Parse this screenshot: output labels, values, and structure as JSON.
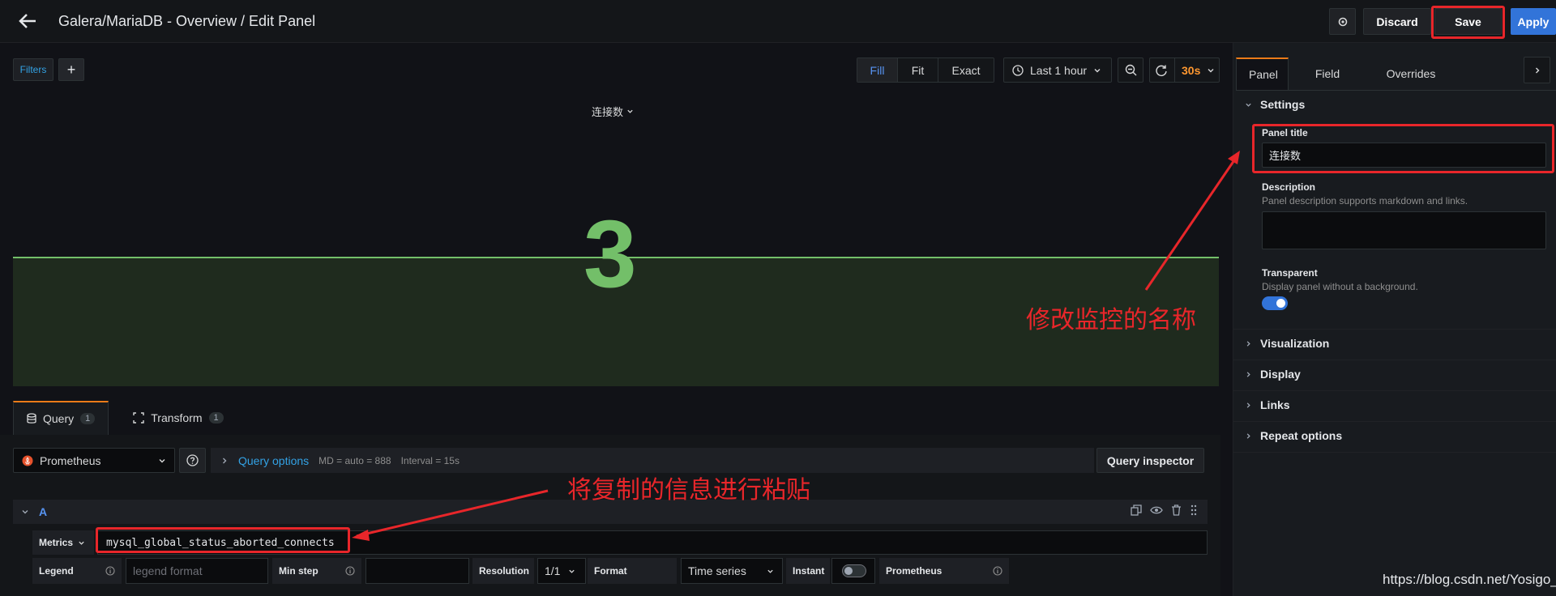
{
  "header": {
    "title": "Galera/MariaDB - Overview / Edit Panel",
    "discard_label": "Discard",
    "save_label": "Save",
    "apply_label": "Apply"
  },
  "toolbar": {
    "filters_label": "Filters",
    "add_label": "+",
    "fill_options": [
      "Fill",
      "Fit",
      "Exact"
    ],
    "active_fill": "Fill",
    "time_range": "Last 1 hour",
    "refresh_interval": "30s"
  },
  "panel": {
    "title": "连接数",
    "stat_value": "3",
    "value_color": "#73bf69"
  },
  "query_tabs": [
    {
      "label": "Query",
      "count": "1"
    },
    {
      "label": "Transform",
      "count": "1"
    }
  ],
  "query": {
    "datasource": "Prometheus",
    "options_label": "Query options",
    "md_text": "MD = auto = 888",
    "interval_text": "Interval = 15s",
    "inspector_label": "Query inspector",
    "ref_id": "A",
    "metrics_label": "Metrics",
    "metrics_value": "mysql_global_status_aborted_connects",
    "legend_label": "Legend",
    "legend_placeholder": "legend format",
    "min_step_label": "Min step",
    "resolution_label": "Resolution",
    "resolution_value": "1/1",
    "format_label": "Format",
    "format_value": "Time series",
    "instant_label": "Instant",
    "prometheus_label": "Prometheus"
  },
  "options_pane": {
    "tabs": [
      "Panel",
      "Field",
      "Overrides"
    ],
    "settings_label": "Settings",
    "panel_title_label": "Panel title",
    "panel_title_value": "连接数",
    "description_label": "Description",
    "description_hint": "Panel description supports markdown and links.",
    "transparent_label": "Transparent",
    "transparent_hint": "Display panel without a background.",
    "sections": [
      "Visualization",
      "Display",
      "Links",
      "Repeat options"
    ]
  },
  "annotations": {
    "rename_note": "修改监控的名称",
    "paste_note": "将复制的信息进行粘贴"
  },
  "watermark": "https://blog.csdn.net/Yosigo_",
  "colors": {
    "accent": "#3274d9",
    "highlight": "#e8262a",
    "tab_active": "#eb7b18",
    "refresh": "#ff9830"
  }
}
